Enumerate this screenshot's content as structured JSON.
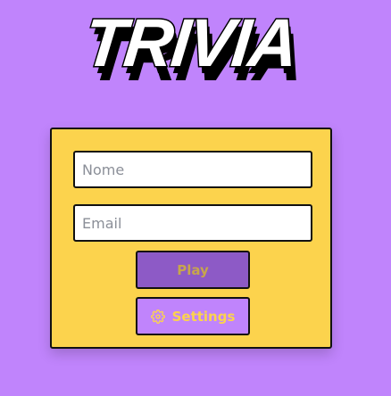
{
  "logo": {
    "text": "TRIVIA"
  },
  "form": {
    "name_placeholder": "Nome",
    "email_placeholder": "Email",
    "play_label": "Play",
    "settings_label": "Settings",
    "settings_icon": "gear-icon"
  },
  "colors": {
    "background": "#c084fc",
    "card": "#fcd34d",
    "play_button": "#8d5ac6",
    "accent_text": "#fcd34d"
  }
}
